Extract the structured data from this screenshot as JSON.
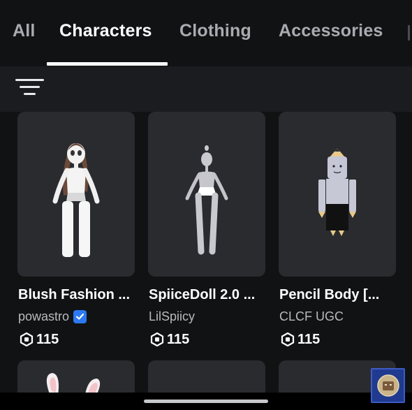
{
  "tabs": [
    {
      "label": "All"
    },
    {
      "label": "Characters"
    },
    {
      "label": "Clothing"
    },
    {
      "label": "Accessories"
    }
  ],
  "active_tab": "Characters",
  "filter": {
    "icon": "filter-lines-icon"
  },
  "items": [
    {
      "name": "Blush Fashion ...",
      "creator": "powastro",
      "verified": true,
      "price": "115",
      "currency_icon": "robux-icon"
    },
    {
      "name": "SpiiceDoll 2.0 ...",
      "creator": "LilSpiicy",
      "verified": false,
      "price": "115",
      "currency_icon": "robux-icon"
    },
    {
      "name": "Pencil Body [...",
      "creator": "CLCF UGC",
      "verified": false,
      "price": "115",
      "currency_icon": "robux-icon"
    }
  ],
  "colors": {
    "background": "#111214",
    "card": "#2a2b2f",
    "verified": "#2d79f3",
    "muted_text": "#b8babe"
  }
}
